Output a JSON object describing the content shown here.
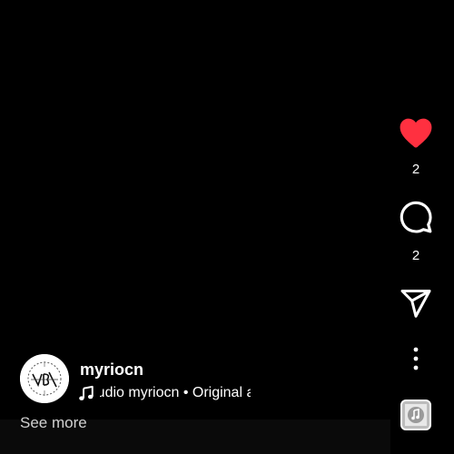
{
  "post": {
    "username": "myriocn",
    "audio_text": "Audio    myriocn • Original audio",
    "see_more": "See more"
  },
  "actions": {
    "like_count": "2",
    "comment_count": "2",
    "liked": true
  },
  "icons": {
    "like": "heart-icon",
    "comment": "comment-bubble-icon",
    "share": "paper-plane-icon",
    "more": "vertical-dots-icon",
    "audio": "music-note-icon"
  },
  "colors": {
    "background": "#000000",
    "liked_heart": "#ff3040",
    "text": "#ffffff",
    "muted_text": "#d0d0d0"
  }
}
